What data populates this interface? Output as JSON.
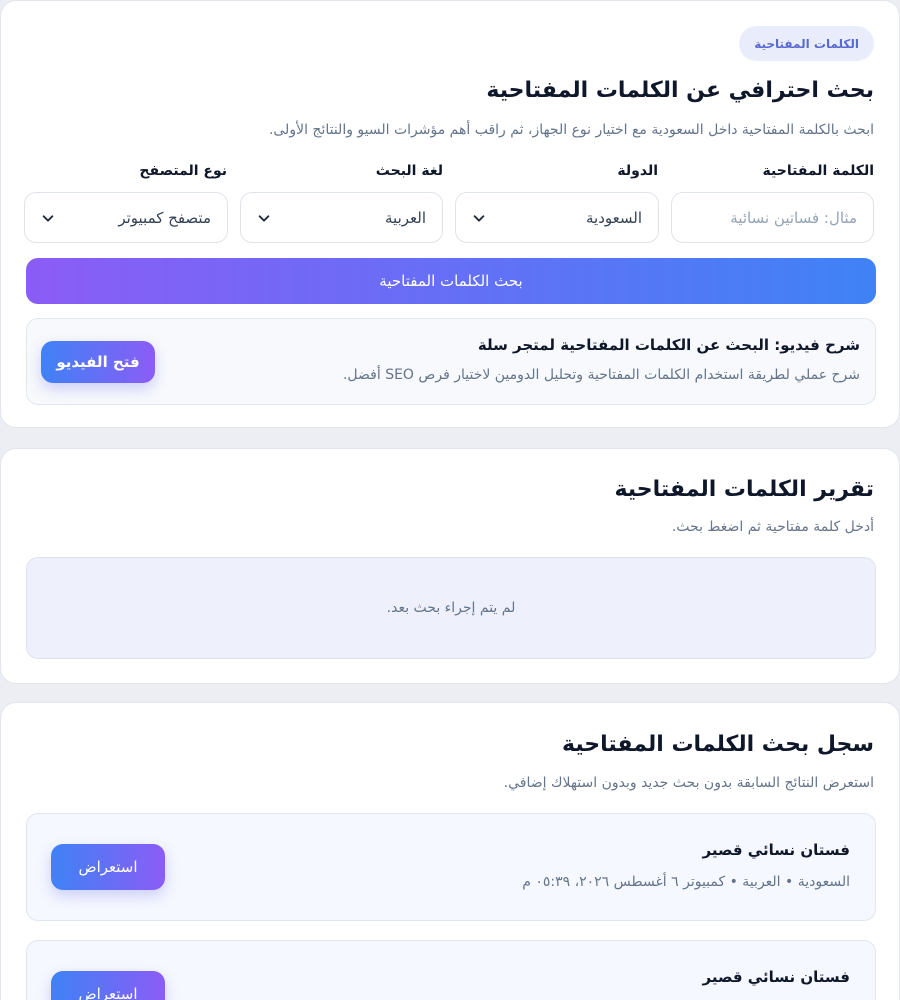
{
  "search_card": {
    "badge": "الكلمات المفتاحية",
    "title": "بحث احترافي عن الكلمات المفتاحية",
    "subtitle": "ابحث بالكلمة المفتاحية داخل السعودية مع اختيار نوع الجهاز، ثم راقب أهم مؤشرات السيو والنتائج الأولى.",
    "fields": {
      "keyword": {
        "label": "الكلمة المفتاحية",
        "placeholder": "مثال: فساتين نسائية"
      },
      "country": {
        "label": "الدولة",
        "value": "السعودية"
      },
      "language": {
        "label": "لغة البحث",
        "value": "العربية"
      },
      "browser": {
        "label": "نوع المتصفح",
        "value": "متصفح كمبيوتر"
      }
    },
    "search_button": "بحث الكلمات المفتاحية",
    "video": {
      "title": "شرح فيديو: البحث عن الكلمات المفتاحية لمتجر سلة",
      "description": "شرح عملي لطريقة استخدام الكلمات المفتاحية وتحليل الدومين لاختيار فرص SEO أفضل.",
      "button": "فتح الفيديو"
    }
  },
  "report_card": {
    "title": "تقرير الكلمات المفتاحية",
    "subtitle": "أدخل كلمة مفتاحية ثم اضغط بحث.",
    "empty_state": "لم يتم إجراء بحث بعد."
  },
  "history_card": {
    "title": "سجل بحث الكلمات المفتاحية",
    "subtitle": "استعرض النتائج السابقة بدون بحث جديد وبدون استهلاك إضافي.",
    "items": [
      {
        "keyword": "فستان نسائي قصير",
        "meta": "السعودية • العربية • كمبيوتر ٦ أغسطس ٢٠٢٦، ٠٥:٣٩ م",
        "button": "استعراض"
      },
      {
        "keyword": "فستان نسائي قصير",
        "button": "استعراض"
      }
    ]
  },
  "colors": {
    "accent_start": "#3f82f6",
    "accent_end": "#8b5cf6",
    "page_background": "#eceef3"
  },
  "icons": {
    "select_arrow": "chevron-down-icon"
  }
}
